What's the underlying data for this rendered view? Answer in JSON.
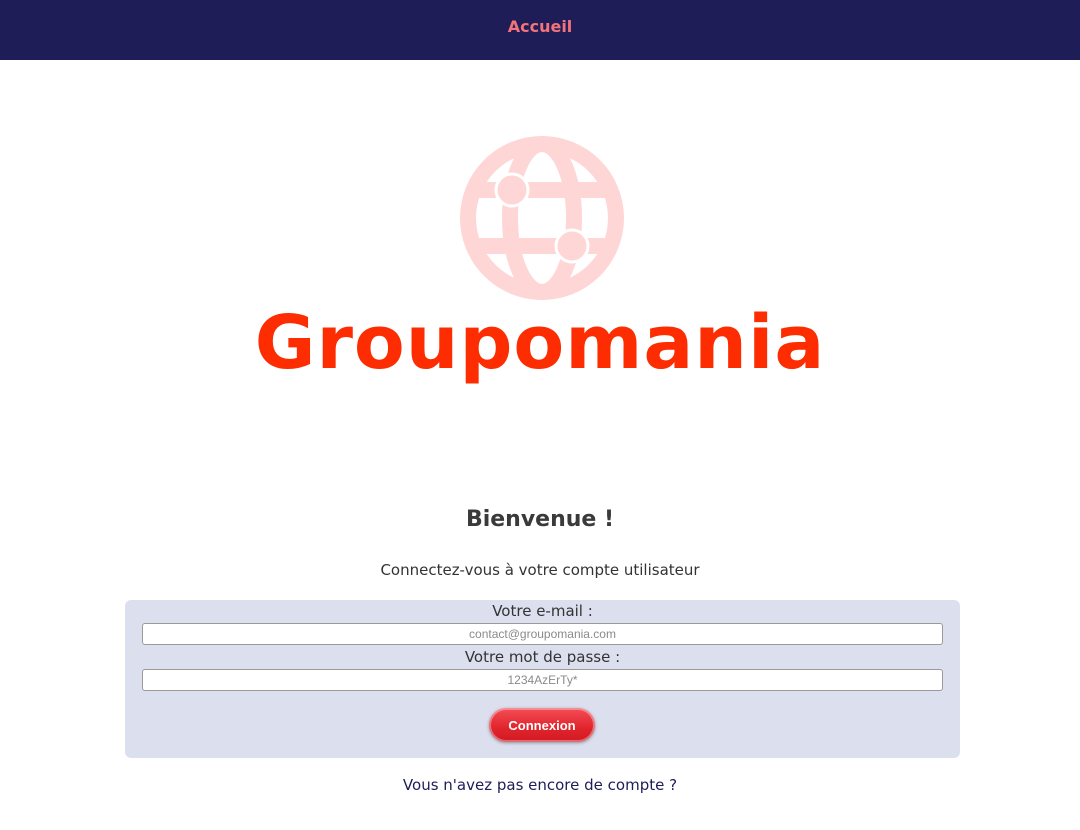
{
  "navbar": {
    "home_label": "Accueil",
    "background_color": "#1e1d57",
    "link_color": "#f2737a"
  },
  "logo": {
    "icon": "globe-icon",
    "icon_color": "#ffd6d6",
    "text": "Groupomania",
    "text_color": "#fd2d01"
  },
  "login": {
    "title": "Bienvenue !",
    "subtitle": "Connectez-vous à votre compte utilisateur",
    "email_label": "Votre e-mail :",
    "email_placeholder": "contact@groupomania.com",
    "email_value": "",
    "password_label": "Votre mot de passe :",
    "password_placeholder": "1234AzErTy*",
    "password_value": "",
    "submit_label": "Connexion",
    "panel_color": "#dcdfee",
    "button_color": "#e0242c"
  },
  "footer": {
    "signup_text": "Vous n'avez pas encore de compte ?"
  }
}
